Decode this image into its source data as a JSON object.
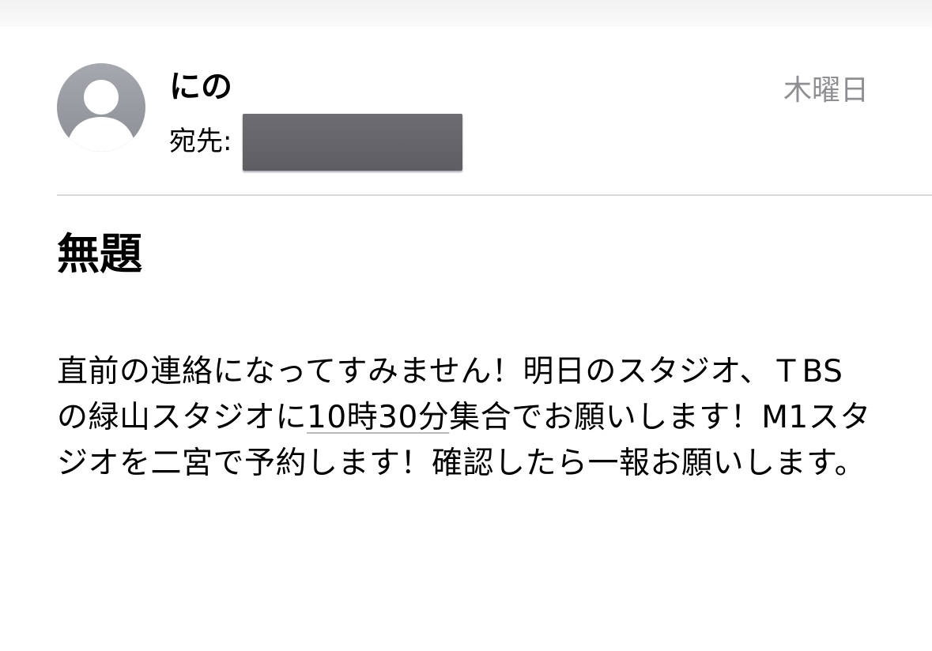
{
  "message": {
    "sender": {
      "name": "にの",
      "avatar_icon": "person-placeholder-icon"
    },
    "recipient": {
      "label": "宛先:",
      "value_redacted": true
    },
    "date": "木曜日",
    "subject": "無題",
    "body": {
      "before_link": "直前の連絡になってすみません！明日のスタジオ、ＴBSの緑山スタジオに",
      "link_text": "10時30分",
      "after_link": "集合でお願いします！M1スタジオを二宮で予約します！確認したら一報お願いします。"
    }
  },
  "colors": {
    "date_gray": "#8e8e93",
    "divider": "#d9d9dc",
    "avatar_gray": "#9a9da3",
    "redaction": "#666669"
  }
}
